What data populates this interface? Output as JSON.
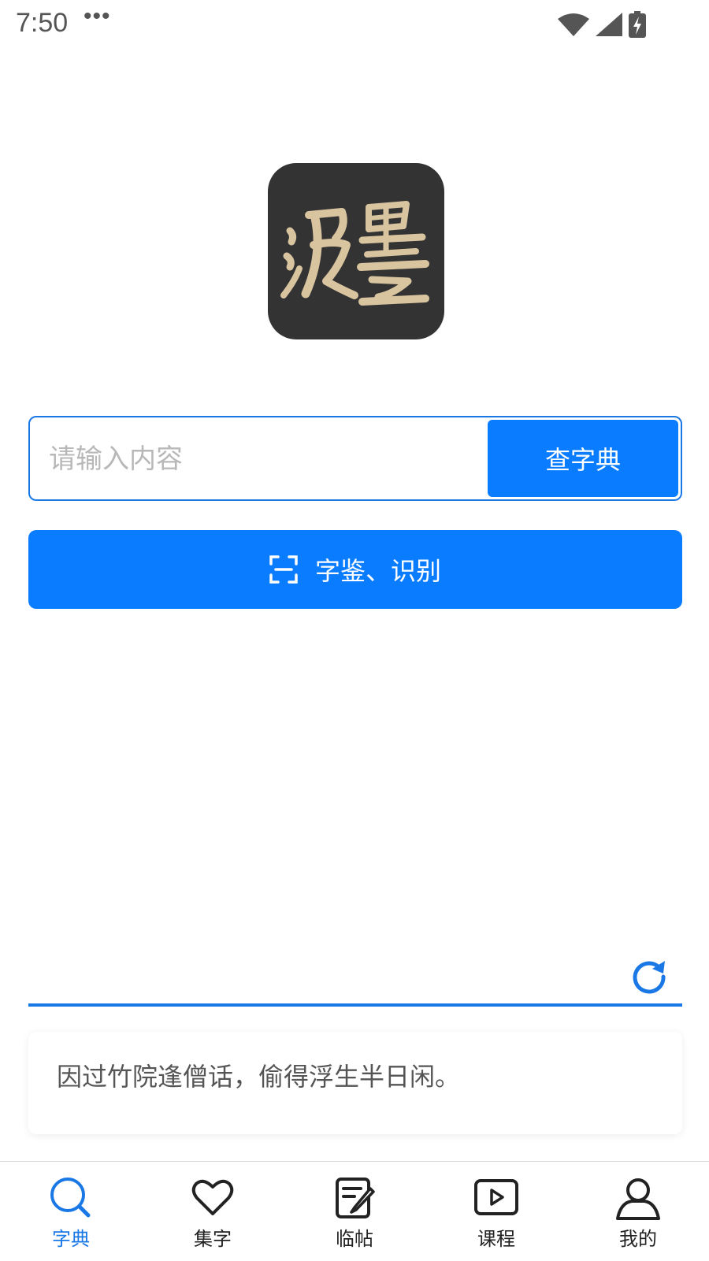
{
  "status_bar": {
    "time": "7:50",
    "more": "•••",
    "icons": [
      "wifi-icon",
      "signal-icon",
      "battery-charging-icon"
    ]
  },
  "logo": {
    "text": "汲墨",
    "colors": {
      "background": "#333333",
      "glyph": "#d9c4a0"
    }
  },
  "search": {
    "placeholder": "请输入内容",
    "value": "",
    "button_label": "查字典"
  },
  "recognize": {
    "label": "字鉴、识别",
    "icon": "scan-icon"
  },
  "refresh": {
    "icon": "refresh-icon"
  },
  "quote": {
    "text": "因过竹院逢僧话，偷得浮生半日闲。"
  },
  "bottom_nav": {
    "items": [
      {
        "label": "字典",
        "icon": "search-icon",
        "active": true
      },
      {
        "label": "集字",
        "icon": "heart-icon",
        "active": false
      },
      {
        "label": "临帖",
        "icon": "edit-note-icon",
        "active": false
      },
      {
        "label": "课程",
        "icon": "play-icon",
        "active": false
      },
      {
        "label": "我的",
        "icon": "user-icon",
        "active": false
      }
    ]
  },
  "colors": {
    "accent": "#0a7cff",
    "accent_line": "#1a78e6",
    "placeholder": "#b8b8b8"
  }
}
